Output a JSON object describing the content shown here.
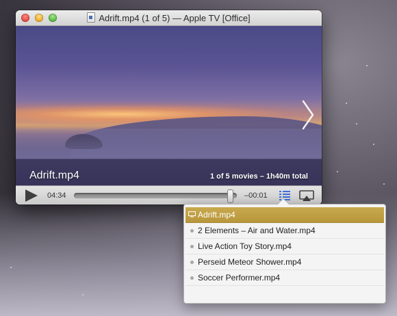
{
  "window": {
    "title": "Adrift.mp4 (1 of 5) — Apple TV [Office]"
  },
  "video": {
    "title": "Adrift.mp4",
    "summary": "1 of 5 movies – 1h40m total"
  },
  "controls": {
    "elapsed": "04:34",
    "remaining": "–00:01",
    "progress_fraction": 0.98
  },
  "playlist": {
    "items": [
      {
        "label": "Adrift.mp4",
        "active": true
      },
      {
        "label": "2 Elements – Air and Water.mp4",
        "active": false
      },
      {
        "label": "Live Action Toy Story.mp4",
        "active": false
      },
      {
        "label": "Perseid Meteor Shower.mp4",
        "active": false
      },
      {
        "label": "Soccer Performer.mp4",
        "active": false
      }
    ]
  },
  "icons": {
    "document": "document-icon",
    "next": "chevron-right-icon",
    "play": "play-icon",
    "playlist": "list-icon",
    "airplay": "airplay-icon",
    "now_playing": "screen-icon"
  },
  "colors": {
    "highlight": "#b8973c",
    "playlist_icon": "#3a6fd8"
  }
}
